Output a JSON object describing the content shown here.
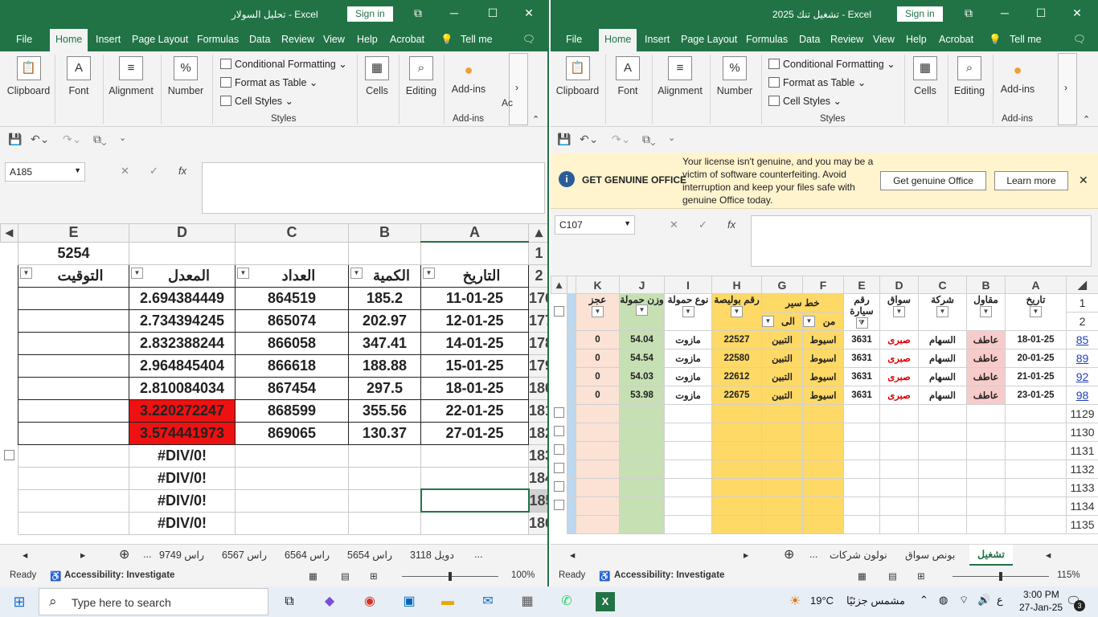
{
  "left": {
    "title": "تحليل السولار  -  Excel",
    "signin": "Sign in",
    "menu": [
      "File",
      "Home",
      "Insert",
      "Page Layout",
      "Formulas",
      "Data",
      "Review",
      "View",
      "Help",
      "Acrobat",
      "Tell me"
    ],
    "ribbon": {
      "clipboard": "Clipboard",
      "font": "Font",
      "alignment": "Alignment",
      "number": "Number",
      "cond": "Conditional Formatting",
      "format_table": "Format as Table",
      "cell_styles": "Cell Styles",
      "styles": "Styles",
      "cells": "Cells",
      "editing": "Editing",
      "addins": "Add-ins",
      "addins_group": "Add-ins",
      "ac": "Ac"
    },
    "namebox": "A185",
    "cols": [
      "E",
      "D",
      "C",
      "B",
      "A"
    ],
    "e1": "5254",
    "headers": {
      "e": "التوقيت",
      "d": "المعدل",
      "c": "العداد",
      "b": "الكمية",
      "a": "التاريخ"
    },
    "rows": [
      {
        "n": "176",
        "d": "2.694384449",
        "c": "864519",
        "b": "185.2",
        "a": "11-01-25"
      },
      {
        "n": "177",
        "d": "2.734394245",
        "c": "865074",
        "b": "202.97",
        "a": "12-01-25"
      },
      {
        "n": "178",
        "d": "2.832388244",
        "c": "866058",
        "b": "347.41",
        "a": "14-01-25"
      },
      {
        "n": "179",
        "d": "2.964845404",
        "c": "866618",
        "b": "188.88",
        "a": "15-01-25"
      },
      {
        "n": "180",
        "d": "2.810084034",
        "c": "867454",
        "b": "297.5",
        "a": "18-01-25"
      },
      {
        "n": "181",
        "d": "3.220272247",
        "c": "868599",
        "b": "355.56",
        "a": "22-01-25"
      },
      {
        "n": "182",
        "d": "3.574441973",
        "c": "869065",
        "b": "130.37",
        "a": "27-01-25"
      },
      {
        "n": "183",
        "d": "#DIV/0!",
        "c": "",
        "b": "",
        "a": ""
      },
      {
        "n": "184",
        "d": "#DIV/0!",
        "c": "",
        "b": "",
        "a": ""
      },
      {
        "n": "185",
        "d": "#DIV/0!",
        "c": "",
        "b": "",
        "a": ""
      },
      {
        "n": "186",
        "d": "#DIV/0!",
        "c": "",
        "b": "",
        "a": ""
      }
    ],
    "tabs": [
      "... ",
      "راس 9749",
      "راس 6567",
      "راس 6564",
      "راس 5654",
      "دويل 3118",
      "..."
    ],
    "status": {
      "ready": "Ready",
      "access": "Accessibility: Investigate",
      "zoom": "100%"
    }
  },
  "right": {
    "title": "تشغيل تنك 2025  -  Excel",
    "signin": "Sign in",
    "menu": [
      "File",
      "Home",
      "Insert",
      "Page Layout",
      "Formulas",
      "Data",
      "Review",
      "View",
      "Help",
      "Acrobat",
      "Tell me"
    ],
    "ribbon": {
      "clipboard": "Clipboard",
      "font": "Font",
      "alignment": "Alignment",
      "number": "Number",
      "cond": "Conditional Formatting",
      "format_table": "Format as Table",
      "cell_styles": "Cell Styles",
      "styles": "Styles",
      "cells": "Cells",
      "editing": "Editing",
      "addins": "Add-ins",
      "addins_group": "Add-ins"
    },
    "license": {
      "title": "GET GENUINE OFFICE",
      "message": "Your license isn't genuine, and you may be a victim of software counterfeiting. Avoid interruption and keep your files safe with genuine Office today.",
      "get": "Get genuine Office",
      "learn": "Learn more"
    },
    "namebox": "C107",
    "cols": [
      "K",
      "J",
      "I",
      "H",
      "G",
      "F",
      "E",
      "D",
      "C",
      "B",
      "A"
    ],
    "headers": {
      "k": "عجز",
      "j": "وزن حمولة",
      "i": "نوع حمولة",
      "h": "رقم بوليصة",
      "gf": "خط سير",
      "g": "الى",
      "f": "من",
      "e": "رقم سيارة",
      "d": "سواق",
      "c": "شركة",
      "b": "مقاول",
      "a": "تاريخ"
    },
    "hdr_rows": [
      "1",
      "2"
    ],
    "rows": [
      {
        "n": "85",
        "k": "0",
        "j": "54.04",
        "i": "مازوت",
        "h": "22527",
        "g": "التبين",
        "f": "اسيوط",
        "e": "3631",
        "d": "صبرى",
        "c": "السهام",
        "b": "عاطف",
        "a": "18-01-25"
      },
      {
        "n": "89",
        "k": "0",
        "j": "54.54",
        "i": "مازوت",
        "h": "22580",
        "g": "التبين",
        "f": "اسيوط",
        "e": "3631",
        "d": "صبرى",
        "c": "السهام",
        "b": "عاطف",
        "a": "20-01-25"
      },
      {
        "n": "92",
        "k": "0",
        "j": "54.03",
        "i": "مازوت",
        "h": "22612",
        "g": "التبين",
        "f": "اسيوط",
        "e": "3631",
        "d": "صبرى",
        "c": "السهام",
        "b": "عاطف",
        "a": "21-01-25"
      },
      {
        "n": "98",
        "k": "0",
        "j": "53.98",
        "i": "مازوت",
        "h": "22675",
        "g": "التبين",
        "f": "اسيوط",
        "e": "3631",
        "d": "صبرى",
        "c": "السهام",
        "b": "عاطف",
        "a": "23-01-25"
      }
    ],
    "empty_rows": [
      "1129",
      "1130",
      "1131",
      "1132",
      "1133",
      "1134",
      "1135"
    ],
    "tabs": [
      "نولون شركات",
      "بونص سواق",
      "تشغيل"
    ],
    "status": {
      "ready": "Ready",
      "access": "Accessibility: Investigate",
      "zoom": "115%"
    }
  },
  "taskbar": {
    "search": "Type here to search",
    "weather": "19°C",
    "weather_text": "مشمس جزئيًا",
    "lang": "ع",
    "time": "3:00 PM",
    "date": "27-Jan-25",
    "notif": "3"
  }
}
